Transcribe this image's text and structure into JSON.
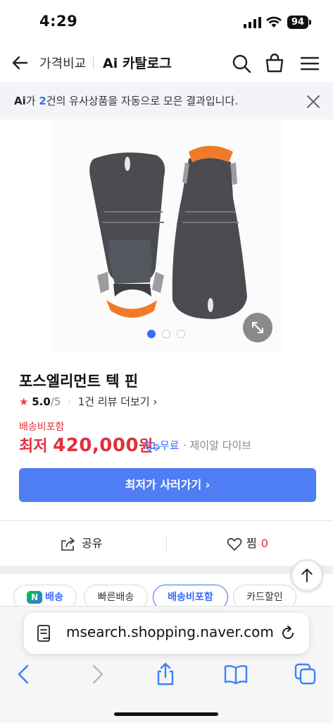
{
  "status_bar": {
    "time": "4:29",
    "battery": "94"
  },
  "header": {
    "title": "가격비교",
    "subtitle": "Ai 카탈로그"
  },
  "ai_banner": {
    "logo": "Ai",
    "prefix": "가 ",
    "count": "2",
    "suffix": "건의 유사상품을 자동으로 모은 결과입니다."
  },
  "product": {
    "title": "포스엘리먼트 텍 핀",
    "star": "★",
    "rating": "5.0",
    "rating_max": "/5",
    "dot": "·",
    "review_link": "1건 리뷰 더보기 ›",
    "shipping_included": "배송비포함",
    "price_label": "최저 ",
    "price": "420,000",
    "price_unit": "원",
    "free_shipping": "무료",
    "seller": "· 제이알 다이브",
    "buy_button": "최저가 사러가기 ›",
    "image_dots": 3,
    "active_dot": 0
  },
  "actions": {
    "share": "공유",
    "like": "찜",
    "like_count": "0"
  },
  "chips": [
    {
      "label": "배송",
      "badge": "N"
    },
    {
      "label": "빠른배송"
    },
    {
      "label": "배송비포함"
    },
    {
      "label": "카드할인"
    }
  ],
  "safari": {
    "url": "msearch.shopping.naver.com"
  },
  "colors": {
    "accent_blue": "#4f7df3",
    "price_red": "#e0303c",
    "banner_bg": "#f2f4f8"
  },
  "icons": [
    "back-arrow-icon",
    "search-icon",
    "cart-icon",
    "menu-icon",
    "close-icon",
    "expand-icon",
    "share-icon",
    "heart-icon",
    "arrow-up-icon",
    "page-icon",
    "reload-icon",
    "chevron-left-icon",
    "chevron-right-icon",
    "share-up-icon",
    "book-icon",
    "tabs-icon"
  ]
}
